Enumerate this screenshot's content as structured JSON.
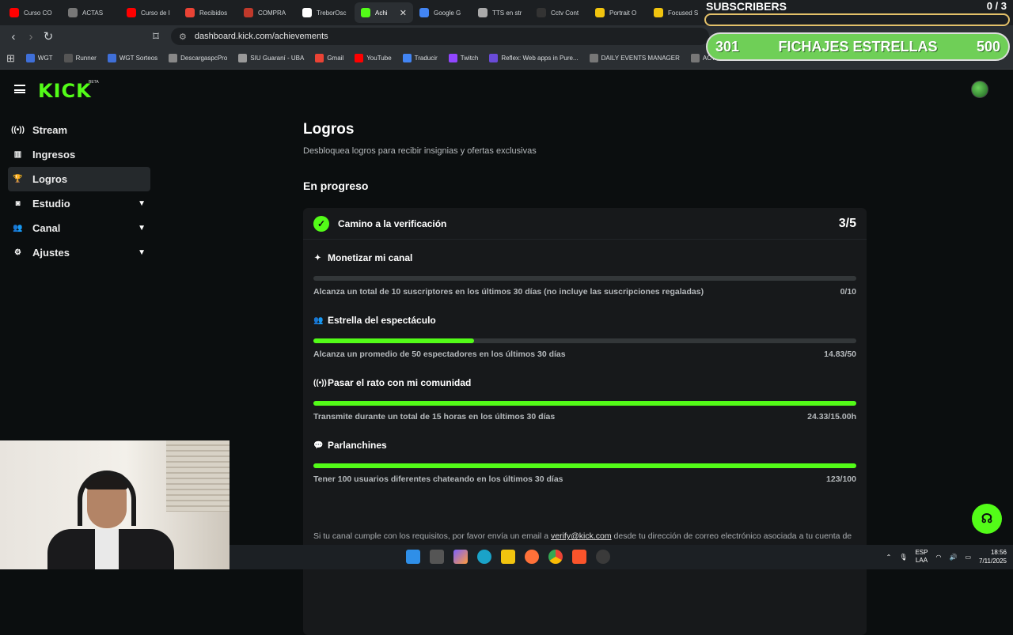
{
  "browser": {
    "tabs": [
      {
        "label": "Curso CO",
        "color": "#ff0000"
      },
      {
        "label": "ACTAS",
        "color": "#777777"
      },
      {
        "label": "Curso de I",
        "color": "#ff0000"
      },
      {
        "label": "Recibidos",
        "color": "#ea4335"
      },
      {
        "label": "COMPRA",
        "color": "#c0392b"
      },
      {
        "label": "TreborOsc",
        "color": "#ffffff"
      },
      {
        "label": "Achi",
        "color": "#53fc18",
        "active": true
      },
      {
        "label": "Google G",
        "color": "#4285f4"
      },
      {
        "label": "TTS en str",
        "color": "#aaaaaa"
      },
      {
        "label": "Cctv Cont",
        "color": "#333333"
      },
      {
        "label": "Portrait O",
        "color": "#f1c40f"
      },
      {
        "label": "Focused S",
        "color": "#f1c40f"
      }
    ],
    "url": "dashboard.kick.com/achievements",
    "bookmarks": [
      {
        "label": "WGT",
        "color": "#3f6fd8"
      },
      {
        "label": "Runner",
        "color": "#555555"
      },
      {
        "label": "WGT Sorteos",
        "color": "#3f6fd8"
      },
      {
        "label": "DescargaspcPro",
        "color": "#888888"
      },
      {
        "label": "SIU Guaraní - UBA",
        "color": "#999999"
      },
      {
        "label": "Gmail",
        "color": "#ea4335"
      },
      {
        "label": "YouTube",
        "color": "#ff0000"
      },
      {
        "label": "Traducir",
        "color": "#4285f4"
      },
      {
        "label": "Twitch",
        "color": "#9146ff"
      },
      {
        "label": "Reflex: Web apps in Pure...",
        "color": "#6a4bd8"
      },
      {
        "label": "DAILY EVENTS MANAGER",
        "color": "#777777"
      },
      {
        "label": "ACTAS",
        "color": "#777777"
      }
    ]
  },
  "overlay": {
    "title": "SUBSCRIBERS",
    "count": "0 / 3",
    "goal_current": "301",
    "goal_label": "FICHAJES ESTRELLAS",
    "goal_target": "500"
  },
  "app": {
    "logo": "KICK",
    "beta": "BETA",
    "sidebar": [
      {
        "label": "Stream",
        "icon": "broadcast-icon",
        "glyph": "((•))",
        "expandable": false
      },
      {
        "label": "Ingresos",
        "icon": "chart-icon",
        "glyph": "▥",
        "expandable": false
      },
      {
        "label": "Logros",
        "icon": "trophy-icon",
        "glyph": "🏆",
        "expandable": false,
        "active": true
      },
      {
        "label": "Estudio",
        "icon": "studio-icon",
        "glyph": "◙",
        "expandable": true
      },
      {
        "label": "Canal",
        "icon": "channel-icon",
        "glyph": "👥",
        "expandable": true
      },
      {
        "label": "Ajustes",
        "icon": "gear-icon",
        "glyph": "⚙",
        "expandable": true
      }
    ]
  },
  "main": {
    "title": "Logros",
    "subtitle": "Desbloquea logros para recibir insignias y ofertas exclusivas",
    "section": "En progreso",
    "card": {
      "title": "Camino a la verificación",
      "count": "3/5",
      "achievements": [
        {
          "title": "Monetizar mi canal",
          "icon": "sparkle-icon",
          "glyph": "✦",
          "desc": "Alcanza un total de 10 suscriptores en los últimos 30 días (no incluye las suscripciones regaladas)",
          "value": "0/10",
          "progress": 0.0
        },
        {
          "title": "Estrella del espectáculo",
          "icon": "users-icon",
          "glyph": "👥",
          "desc": "Alcanza un promedio de 50 espectadores en los últimos 30 días",
          "value": "14.83/50",
          "progress": 0.2966
        },
        {
          "title": "Pasar el rato con mi comunidad",
          "icon": "broadcast-icon",
          "glyph": "((•))",
          "desc": "Transmite durante un total de 15 horas en los últimos 30 días",
          "value": "24.33/15.00h",
          "progress": 1.0
        },
        {
          "title": "Parlanchines",
          "icon": "chat-icon",
          "glyph": "💬",
          "desc": "Tener 100 usuarios diferentes chateando en los últimos 30 días",
          "value": "123/100",
          "progress": 1.0
        }
      ],
      "footnote_pre": "Si tu canal cumple con los requisitos, por favor envía un email a ",
      "footnote_link": "verify@kick.com",
      "footnote_post": " desde tu dirección de correo electrónico asociada a tu cuenta de Kick, con la siguiente información: tu nombre de usuario y qué tipo de contenido streameas."
    }
  },
  "taskbar": {
    "lang": "ESP",
    "lang2": "LAA",
    "time": "18:56",
    "date": "7/11/2025"
  },
  "colors": {
    "accent": "#53fc18",
    "background": "#0b0e0f",
    "card": "#17191b"
  }
}
